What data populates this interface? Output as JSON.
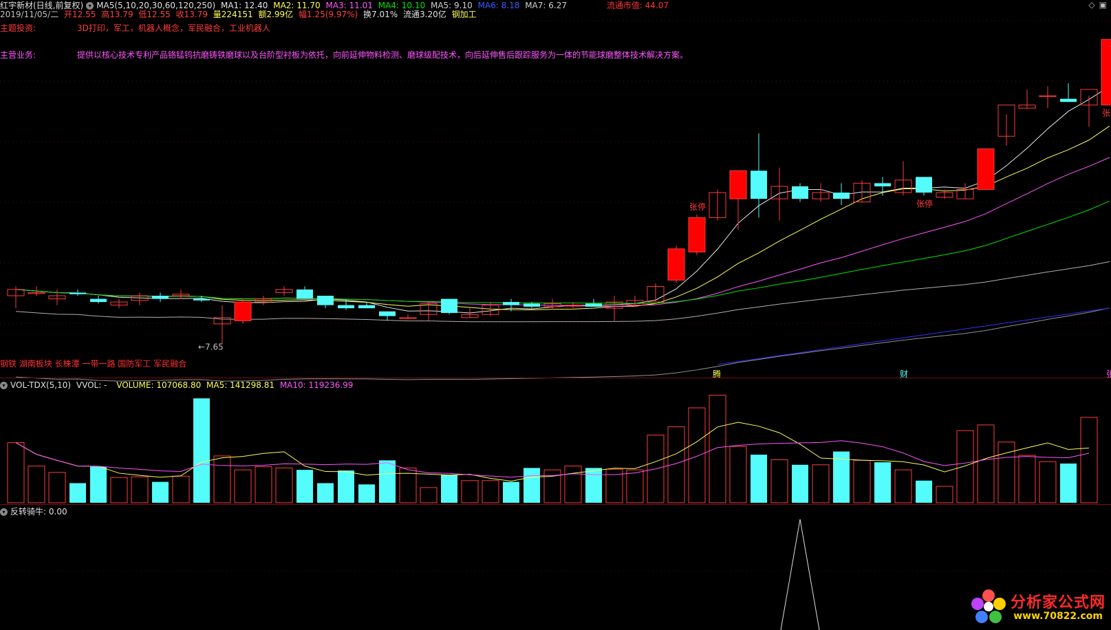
{
  "header": {
    "stock": "红宇新材(日线,前复权)",
    "ma_label": "MA5(5,10,20,30,60,120,250)",
    "ma1": "MA1: 12.40",
    "ma2": "MA2: 11.70",
    "ma3": "MA3: 11.01",
    "ma4": "MA4: 10.10",
    "ma5": "MA5: 9.10",
    "ma6": "MA6: 8.18",
    "ma7": "MA7: 6.27",
    "market_cap": "流通市值: 44.07"
  },
  "quote": {
    "date": "2019/11/05/二",
    "open": "开12.55",
    "high": "高13.79",
    "low": "低12.55",
    "close": "收13.79",
    "volume": "量224151",
    "amount": "额2.99亿",
    "change": "幅1.25(9.97%)",
    "turnover": "换7.01%",
    "float": "流通3.20亿",
    "industry": "钢加工"
  },
  "info": {
    "theme_label": "主题投资:",
    "theme_value": "3D打印，军工，机器人概念，军民融合，工业机器人",
    "biz_label": "主营业务:",
    "biz_value": "提供以核心技术专利产品铬锰钨抗磨铸铁磨球以及台阶型衬板为依托，向前延伸物料检测、磨球级配技术，向后延伸售后跟踪服务为一体的节能球磨整体技术解决方案。"
  },
  "annotations": {
    "price_high": "13.79",
    "price_low": "7.65",
    "limit_up": "张停",
    "concepts": "钢铁 湖南板块 长株潭 一带一路 国防军工 军民融合",
    "marker1": "腾",
    "marker2": "财",
    "marker3": "张"
  },
  "volume_header": {
    "name": "VOL-TDX(5,10)",
    "vvol": "VVOL: -",
    "volume": "VOLUME: 107068.80",
    "ma5": "MA5: 141298.81",
    "ma10": "MA10: 119236.99"
  },
  "indicator_header": {
    "name": "反转骑牛",
    "value": ": 0.00"
  },
  "logo": {
    "name": "分析家公式网",
    "url": "www.70822.com"
  },
  "colors": {
    "up": "#ff3c3c",
    "down": "#54fcfc",
    "limit_up_fill": "#ff0000",
    "ma1": "#e8e8e8",
    "ma2": "#ffff55",
    "ma3": "#ff55ff",
    "ma4": "#00e800",
    "ma5": "#b0b0b0",
    "ma6": "#3030ff",
    "ma7": "#909090"
  },
  "chart_data": {
    "type": "candlestick",
    "candles": [
      [
        9.2,
        9.5,
        8.8,
        9.4
      ],
      [
        9.3,
        9.5,
        9.2,
        9.3
      ],
      [
        9.1,
        9.4,
        8.9,
        9.2
      ],
      [
        9.3,
        9.4,
        9.2,
        9.25
      ],
      [
        9.1,
        9.2,
        8.95,
        9.0
      ],
      [
        8.9,
        9.1,
        8.8,
        9.0
      ],
      [
        9.05,
        9.3,
        8.9,
        9.2
      ],
      [
        9.2,
        9.3,
        9.0,
        9.1
      ],
      [
        9.2,
        9.4,
        9.1,
        9.25
      ],
      [
        9.1,
        9.2,
        9.0,
        9.05
      ],
      [
        8.3,
        8.9,
        7.65,
        8.5
      ],
      [
        8.4,
        9.1,
        8.3,
        9.0
      ],
      [
        9.0,
        9.2,
        8.9,
        9.1
      ],
      [
        9.3,
        9.5,
        9.2,
        9.4
      ],
      [
        9.4,
        9.5,
        9.1,
        9.1
      ],
      [
        9.2,
        9.2,
        8.8,
        8.9
      ],
      [
        8.9,
        9.1,
        8.75,
        8.8
      ],
      [
        8.9,
        9.0,
        8.8,
        8.8
      ],
      [
        8.7,
        8.7,
        8.4,
        8.55
      ],
      [
        8.5,
        8.6,
        8.45,
        8.5
      ],
      [
        8.6,
        9.0,
        8.4,
        8.95
      ],
      [
        9.1,
        9.1,
        8.6,
        8.65
      ],
      [
        8.5,
        8.8,
        8.5,
        8.6
      ],
      [
        8.6,
        9.0,
        8.55,
        8.9
      ],
      [
        9.0,
        9.1,
        8.7,
        8.9
      ],
      [
        8.95,
        9.0,
        8.8,
        8.85
      ],
      [
        8.85,
        9.1,
        8.75,
        8.95
      ],
      [
        8.9,
        9.0,
        8.8,
        8.9
      ],
      [
        8.95,
        9.1,
        8.9,
        8.85
      ],
      [
        8.8,
        9.2,
        8.4,
        9.0
      ],
      [
        8.9,
        9.2,
        8.85,
        9.05
      ],
      [
        9.0,
        9.6,
        9.0,
        9.5
      ],
      [
        9.7,
        10.8,
        9.6,
        10.7
      ],
      [
        10.6,
        11.8,
        10.5,
        11.7
      ],
      [
        11.7,
        12.6,
        11.6,
        12.5
      ],
      [
        12.3,
        13.2,
        11.3,
        13.2
      ],
      [
        13.2,
        14.4,
        11.7,
        12.3
      ],
      [
        12.3,
        13.3,
        11.6,
        12.7
      ],
      [
        12.7,
        12.8,
        12.2,
        12.3
      ],
      [
        12.3,
        12.8,
        12.2,
        12.5
      ],
      [
        12.5,
        12.8,
        12.1,
        12.3
      ],
      [
        12.2,
        12.9,
        12.2,
        12.8
      ],
      [
        12.8,
        13.0,
        12.4,
        12.7
      ],
      [
        12.5,
        13.5,
        12.4,
        12.9
      ],
      [
        13.0,
        13.0,
        12.4,
        12.5
      ],
      [
        12.35,
        12.6,
        12.3,
        12.5
      ],
      [
        12.3,
        12.8,
        12.3,
        12.6
      ],
      [
        12.6,
        13.9,
        12.6,
        13.9
      ],
      [
        14.3,
        15.0,
        14.0,
        15.3
      ],
      [
        15.2,
        15.8,
        15.2,
        15.3
      ],
      [
        15.6,
        15.9,
        15.2,
        15.6
      ],
      [
        15.5,
        16.0,
        15.4,
        15.4
      ],
      [
        15.3,
        15.6,
        14.6,
        15.8
      ],
      [
        15.3,
        17.4,
        15.3,
        17.4
      ]
    ],
    "volumes": [
      95000,
      58000,
      48000,
      31000,
      57000,
      40000,
      41000,
      33000,
      42000,
      165000,
      74000,
      52000,
      57000,
      55000,
      52000,
      31000,
      51000,
      29000,
      67000,
      55000,
      24000,
      44000,
      35000,
      35000,
      33000,
      55000,
      52000,
      58000,
      55000,
      53000,
      52000,
      107000,
      120000,
      150000,
      170000,
      89000,
      76000,
      68000,
      60000,
      60000,
      81000,
      67000,
      64000,
      52000,
      35000,
      26000,
      114000,
      123000,
      96000,
      75000,
      65000,
      62000,
      135000,
      0
    ],
    "ylim": [
      7.0,
      18.0
    ],
    "vol_ylim": [
      0,
      175000
    ]
  }
}
